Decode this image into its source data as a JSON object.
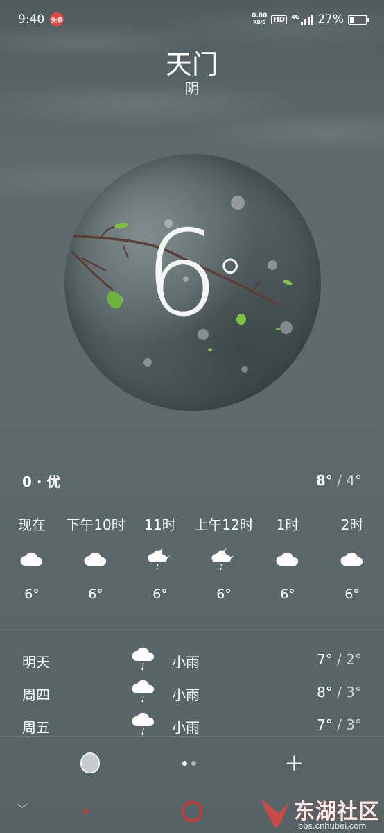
{
  "status_bar": {
    "time": "9:40",
    "news_badge": "头条",
    "net_speed_value": "0.00",
    "net_speed_unit": "KB/S",
    "hd": "HD",
    "network": "4G",
    "battery_text": "27%",
    "battery_level": 0.27
  },
  "header": {
    "city": "天门",
    "condition": "阴"
  },
  "current": {
    "temp": "6",
    "deg_sign": "°"
  },
  "summary": {
    "aqi": "0 · 优",
    "high": "8°",
    "sep": " / ",
    "low": "4°"
  },
  "hourly": [
    {
      "label": "现在",
      "icon": "cloud-icon",
      "temp": "6°"
    },
    {
      "label": "下午10时",
      "icon": "cloud-icon",
      "temp": "6°"
    },
    {
      "label": "11时",
      "icon": "cloud-moon-drizzle-icon",
      "temp": "6°"
    },
    {
      "label": "上午12时",
      "icon": "cloud-moon-drizzle-icon",
      "temp": "6°"
    },
    {
      "label": "1时",
      "icon": "cloud-icon",
      "temp": "6°"
    },
    {
      "label": "2时",
      "icon": "cloud-icon",
      "temp": "6°"
    }
  ],
  "daily": [
    {
      "day": "明天",
      "icon": "cloud-rain-icon",
      "condition": "小雨",
      "high": "7°",
      "sep": " / ",
      "low": "2°"
    },
    {
      "day": "周四",
      "icon": "cloud-rain-icon",
      "condition": "小雨",
      "high": "8°",
      "sep": " / ",
      "low": "3°"
    },
    {
      "day": "周五",
      "icon": "cloud-rain-icon",
      "condition": "小雨",
      "high": "7°",
      "sep": " / ",
      "low": "3°"
    }
  ],
  "toolbar": {
    "add_label": "+",
    "pages": 2,
    "active_page": 1
  },
  "watermark": {
    "text": "东湖社区",
    "url": "bbs.cnhubei.com"
  },
  "colors": {
    "accent_red": "#e0302a",
    "background": "#5e6b6d"
  }
}
